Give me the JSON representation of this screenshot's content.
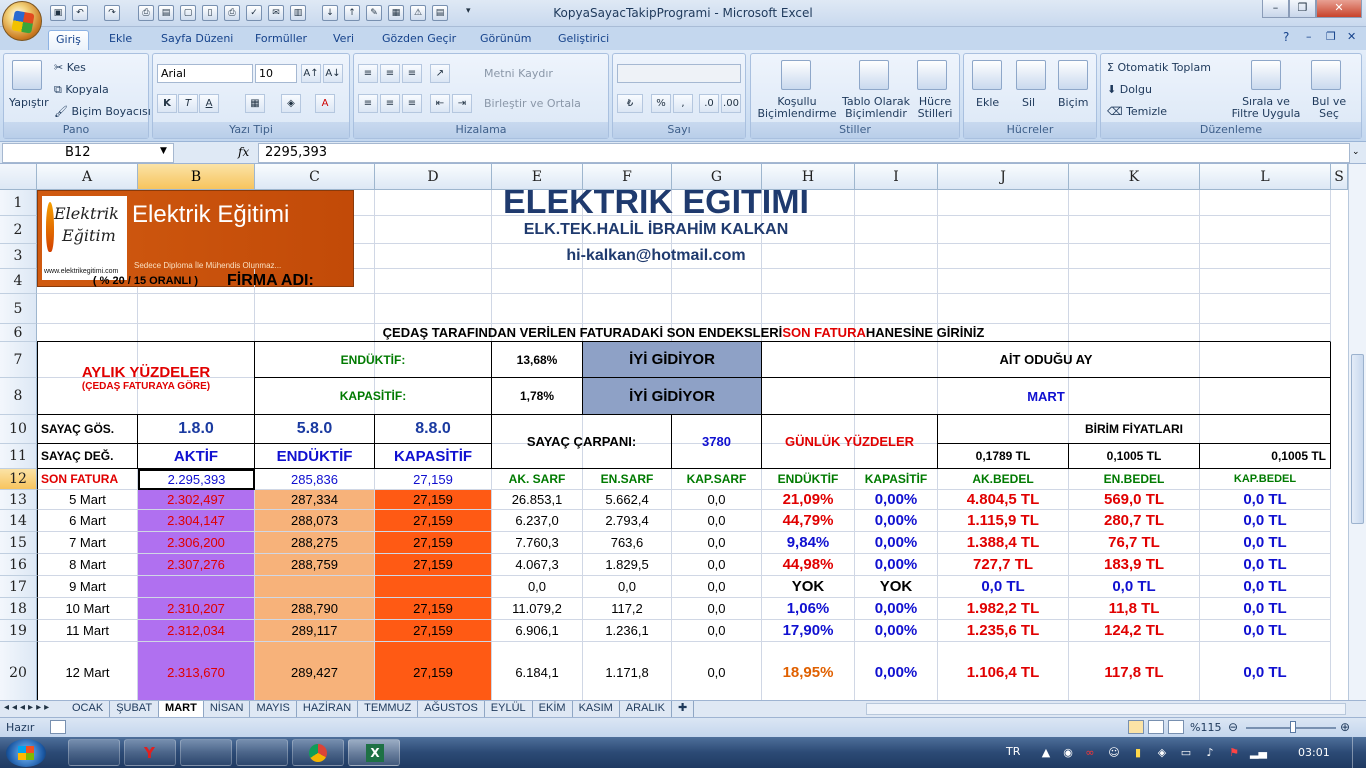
{
  "window": {
    "title": "KopyaSayacTakipProgrami - Microsoft Excel"
  },
  "ribbon_tabs": [
    "Giriş",
    "Ekle",
    "Sayfa Düzeni",
    "Formüller",
    "Veri",
    "Gözden Geçir",
    "Görünüm",
    "Geliştirici"
  ],
  "ribbon": {
    "pano": {
      "label": "Pano",
      "paste": "Yapıştır",
      "cut": "Kes",
      "copy": "Kopyala",
      "format_painter": "Biçim Boyacısı"
    },
    "font": {
      "label": "Yazı Tipi",
      "name": "Arial",
      "size": "10"
    },
    "alignment": {
      "label": "Hizalama",
      "wrap": "Metni Kaydır",
      "merge": "Birleştir ve Ortala"
    },
    "number": {
      "label": "Sayı",
      "format": "",
      "percent": "%"
    },
    "styles": {
      "label": "Stiller",
      "conditional": "Koşullu Biçimlendirme",
      "table": "Tablo Olarak Biçimlendir",
      "cell_styles": "Hücre Stilleri"
    },
    "cells": {
      "label": "Hücreler",
      "insert": "Ekle",
      "delete": "Sil",
      "format": "Biçim"
    },
    "editing": {
      "label": "Düzenleme",
      "autosum": "Otomatik Toplam",
      "fill": "Dolgu",
      "clear": "Temizle",
      "sort": "Sırala ve Filtre Uygula",
      "find": "Bul ve Seç"
    }
  },
  "formula_bar": {
    "name_box": "B12",
    "fx": "fx",
    "value": "2295,393"
  },
  "columns": [
    "A",
    "B",
    "C",
    "D",
    "E",
    "F",
    "G",
    "H",
    "I",
    "J",
    "K",
    "L",
    "S"
  ],
  "row_numbers": [
    "1",
    "2",
    "3",
    "4",
    "5",
    "6",
    "7",
    "8",
    "10",
    "11",
    "12",
    "13",
    "14",
    "15",
    "16",
    "17",
    "18",
    "19",
    "20"
  ],
  "logo": {
    "line1": "Elektrik",
    "line2": "Eğitim",
    "brand": "Elektrik Eğitimi",
    "url": "www.elektrikegitimi.com",
    "tagline": "Sedece Diploma İle Mühendis Olunmaz..."
  },
  "header": {
    "title": "ELEKTRİK EĞİTİMİ",
    "author": "ELK.TEK.HALİL İBRAHİM KALKAN",
    "email": "hi-kalkan@hotmail.com",
    "rate": "( % 20 / 15 ORANLI )",
    "firma": "FİRMA ADI:"
  },
  "banner": {
    "pre": "ÇEDAŞ TARAFINDAN VERİLEN FATURADAKİ SON ENDEKSLERİ ",
    "mid": "SON FATURA",
    "post": " HANESİNE GİRİNİZ"
  },
  "monthly": {
    "title": "AYLIK YÜZDELER",
    "subtitle": "(ÇEDAŞ FATURAYA GÖRE)",
    "ind_label": "ENDÜKTİF:",
    "ind_val": "13,68%",
    "ind_status": "İYİ GİDİYOR",
    "cap_label": "KAPASİTİF:",
    "cap_val": "1,78%",
    "cap_status": "İYİ GİDİYOR",
    "month_label": "AİT ODUĞU AY",
    "month": "MART"
  },
  "meter": {
    "gos": "SAYAÇ GÖS.",
    "deg": "SAYAÇ DEĞ.",
    "c1": "1.8.0",
    "c2": "5.8.0",
    "c3": "8.8.0",
    "n1": "AKTİF",
    "n2": "ENDÜKTİF",
    "n3": "KAPASİTİF",
    "carpan_label": "SAYAÇ ÇARPANI:",
    "carpan": "3780",
    "daily": "GÜNLÜK YÜZDELER",
    "birim": "BİRİM FİYATLARI",
    "p1": "0,1789 TL",
    "p2": "0,1005 TL",
    "p3": "0,1005 TL"
  },
  "son_fatura": {
    "label": "SON FATURA",
    "b": "2.295,393",
    "c": "285,836",
    "d": "27,159",
    "e": "AK. SARF",
    "f": "EN.SARF",
    "g": "KAP.SARF",
    "h": "ENDÜKTİF",
    "i": "KAPASİTİF",
    "j": "AK.BEDEL",
    "k": "EN.BEDEL",
    "l": "KAP.BEDEL"
  },
  "rows": [
    [
      "5 Mart",
      "2.302,497",
      "287,334",
      "27,159",
      "26.853,1",
      "5.662,4",
      "0,0",
      "21,09%",
      "0,00%",
      "4.804,5 TL",
      "569,0 TL",
      "0,0 TL"
    ],
    [
      "6 Mart",
      "2.304,147",
      "288,073",
      "27,159",
      "6.237,0",
      "2.793,4",
      "0,0",
      "44,79%",
      "0,00%",
      "1.115,9 TL",
      "280,7 TL",
      "0,0 TL"
    ],
    [
      "7 Mart",
      "2.306,200",
      "288,275",
      "27,159",
      "7.760,3",
      "763,6",
      "0,0",
      "9,84%",
      "0,00%",
      "1.388,4 TL",
      "76,7 TL",
      "0,0 TL"
    ],
    [
      "8 Mart",
      "2.307,276",
      "288,759",
      "27,159",
      "4.067,3",
      "1.829,5",
      "0,0",
      "44,98%",
      "0,00%",
      "727,7 TL",
      "183,9 TL",
      "0,0 TL"
    ],
    [
      "9 Mart",
      "",
      "",
      "",
      "0,0",
      "0,0",
      "0,0",
      "YOK",
      "YOK",
      "0,0 TL",
      "0,0 TL",
      "0,0 TL"
    ],
    [
      "10 Mart",
      "2.310,207",
      "288,790",
      "27,159",
      "11.079,2",
      "117,2",
      "0,0",
      "1,06%",
      "0,00%",
      "1.982,2 TL",
      "11,8 TL",
      "0,0 TL"
    ],
    [
      "11 Mart",
      "2.312,034",
      "289,117",
      "27,159",
      "6.906,1",
      "1.236,1",
      "0,0",
      "17,90%",
      "0,00%",
      "1.235,6 TL",
      "124,2 TL",
      "0,0 TL"
    ],
    [
      "12 Mart",
      "2.313,670",
      "289,427",
      "27,159",
      "6.184,1",
      "1.171,8",
      "0,0",
      "18,95%",
      "0,00%",
      "1.106,4 TL",
      "117,8 TL",
      "0,0 TL"
    ]
  ],
  "sheet_tabs": [
    "OCAK",
    "ŞUBAT",
    "MART",
    "NİSAN",
    "MAYIS",
    "HAZİRAN",
    "TEMMUZ",
    "AĞUSTOS",
    "EYLÜL",
    "EKİM",
    "KASIM",
    "ARALIK"
  ],
  "active_sheet": "MART",
  "status": {
    "ready": "Hazır",
    "zoom": "%115"
  },
  "taskbar": {
    "lang": "TR",
    "time": "03:01"
  }
}
